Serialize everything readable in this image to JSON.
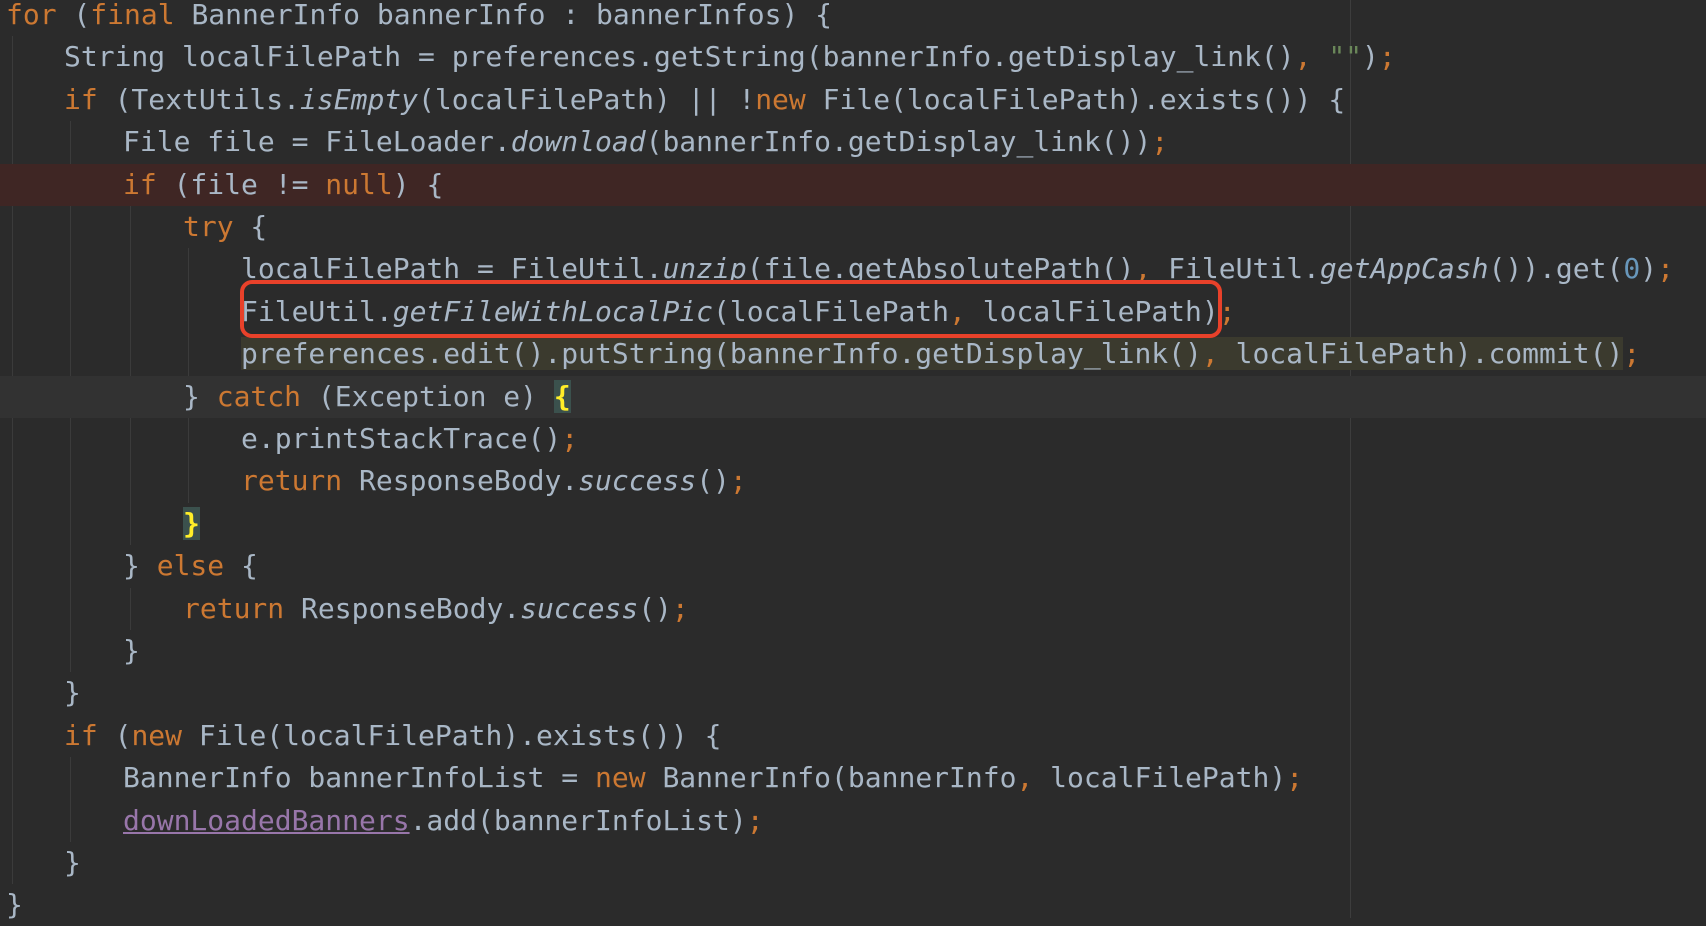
{
  "lines": [
    {
      "segments": [
        {
          "t": "for",
          "c": "kw"
        },
        {
          "t": " ("
        },
        {
          "t": "final",
          "c": "kw"
        },
        {
          "t": " BannerInfo bannerInfo : bannerInfos) {"
        }
      ]
    },
    {
      "segments": [
        {
          "t": "String localFilePath = preferences.getString(bannerInfo.getDisplay_link()"
        },
        {
          "t": ",",
          "c": "kw"
        },
        {
          "t": " "
        },
        {
          "t": "\"\"",
          "c": "str"
        },
        {
          "t": ")"
        },
        {
          "t": ";",
          "c": "kw"
        }
      ]
    },
    {
      "segments": [
        {
          "t": "if",
          "c": "kw"
        },
        {
          "t": " (TextUtils."
        },
        {
          "t": "isEmpty",
          "c": "fn"
        },
        {
          "t": "(localFilePath) || !"
        },
        {
          "t": "new",
          "c": "kw"
        },
        {
          "t": " File(localFilePath).exists()) {"
        }
      ]
    },
    {
      "segments": [
        {
          "t": "File file = FileLoader."
        },
        {
          "t": "download",
          "c": "fn"
        },
        {
          "t": "(bannerInfo.getDisplay_link())"
        },
        {
          "t": ";",
          "c": "kw"
        }
      ]
    },
    {
      "segments": [
        {
          "t": "if",
          "c": "kw"
        },
        {
          "t": " (file != "
        },
        {
          "t": "null",
          "c": "kw"
        },
        {
          "t": ") {"
        }
      ]
    },
    {
      "segments": [
        {
          "t": "try",
          "c": "kw"
        },
        {
          "t": " {"
        }
      ]
    },
    {
      "segments": [
        {
          "t": "localFilePath = FileUtil."
        },
        {
          "t": "unzip",
          "c": "fn"
        },
        {
          "t": "(file.getAbsolutePath()"
        },
        {
          "t": ",",
          "c": "kw"
        },
        {
          "t": " FileUtil."
        },
        {
          "t": "getAppCash",
          "c": "fn"
        },
        {
          "t": "()).get("
        },
        {
          "t": "0",
          "c": "num"
        },
        {
          "t": ")"
        },
        {
          "t": ";",
          "c": "kw"
        }
      ]
    },
    {
      "segments": [
        {
          "t": "FileUtil."
        },
        {
          "t": "getFileWithLocalPic",
          "c": "fn"
        },
        {
          "t": "(localFilePath"
        },
        {
          "t": ",",
          "c": "kw"
        },
        {
          "t": " localFilePath)"
        },
        {
          "t": ";",
          "c": "kw"
        }
      ]
    },
    {
      "segments": [
        {
          "t": "preferences.edit().putString(bannerInfo.getDisplay_link()",
          "c": "sel"
        },
        {
          "t": ",",
          "c": "kw sel"
        },
        {
          "t": " localFilePath).commit()",
          "c": "sel"
        },
        {
          "t": ";",
          "c": "kw"
        }
      ]
    },
    {
      "segments": [
        {
          "t": "} "
        },
        {
          "t": "catch",
          "c": "kw"
        },
        {
          "t": " (Exception e) "
        },
        {
          "t": "{",
          "c": "brace"
        }
      ]
    },
    {
      "segments": [
        {
          "t": "e.printStackTrace()"
        },
        {
          "t": ";",
          "c": "kw"
        }
      ]
    },
    {
      "segments": [
        {
          "t": "return",
          "c": "kw"
        },
        {
          "t": " ResponseBody."
        },
        {
          "t": "success",
          "c": "fn"
        },
        {
          "t": "()"
        },
        {
          "t": ";",
          "c": "kw"
        }
      ]
    },
    {
      "segments": [
        {
          "t": "}",
          "c": "brace"
        }
      ]
    },
    {
      "segments": [
        {
          "t": "} "
        },
        {
          "t": "else",
          "c": "kw"
        },
        {
          "t": " {"
        }
      ]
    },
    {
      "segments": [
        {
          "t": "return",
          "c": "kw"
        },
        {
          "t": " ResponseBody."
        },
        {
          "t": "success",
          "c": "fn"
        },
        {
          "t": "()"
        },
        {
          "t": ";",
          "c": "kw"
        }
      ]
    },
    {
      "segments": [
        {
          "t": "}"
        }
      ]
    },
    {
      "segments": [
        {
          "t": "}"
        }
      ]
    },
    {
      "segments": [
        {
          "t": "if",
          "c": "kw"
        },
        {
          "t": " ("
        },
        {
          "t": "new",
          "c": "kw"
        },
        {
          "t": " File(localFilePath).exists()) {"
        }
      ]
    },
    {
      "segments": [
        {
          "t": "BannerInfo bannerInfoList = "
        },
        {
          "t": "new",
          "c": "kw"
        },
        {
          "t": " BannerInfo(bannerInfo"
        },
        {
          "t": ",",
          "c": "kw"
        },
        {
          "t": " localFilePath)"
        },
        {
          "t": ";",
          "c": "kw"
        }
      ]
    },
    {
      "segments": [
        {
          "t": "downLoadedBanners",
          "c": "field"
        },
        {
          "t": ".add(bannerInfoList)"
        },
        {
          "t": ";",
          "c": "kw"
        }
      ]
    },
    {
      "segments": [
        {
          "t": "}"
        }
      ]
    },
    {
      "segments": [
        {
          "t": "}"
        }
      ]
    }
  ],
  "colors": {
    "background": "#2b2b2b",
    "keyword": "#cc7832",
    "text": "#a9b7c6",
    "string": "#6a8759",
    "number": "#6897bb",
    "field": "#9876aa",
    "highlight_box": "#e8412a",
    "error_line": "#3f2624"
  }
}
